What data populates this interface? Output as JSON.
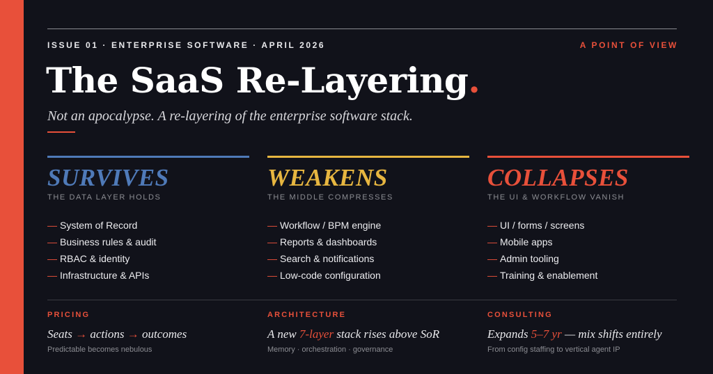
{
  "colors": {
    "accent": "#e8503a",
    "survives": "#4f7ab8",
    "weakens": "#e7b640",
    "collapses": "#e8503a",
    "background": "#11121a"
  },
  "header": {
    "meta": "ISSUE 01 · ENTERPRISE SOFTWARE · APRIL 2026",
    "tag": "A POINT OF VIEW",
    "title": "The SaaS Re-Layering",
    "title_dot": ".",
    "subtitle": "Not an apocalypse. A re-layering of the enterprise software stack."
  },
  "columns": [
    {
      "heading": "SURVIVES",
      "sub": "THE DATA LAYER HOLDS",
      "items": [
        "System of Record",
        "Business rules & audit",
        "RBAC & identity",
        "Infrastructure & APIs"
      ]
    },
    {
      "heading": "WEAKENS",
      "sub": "THE MIDDLE COMPRESSES",
      "items": [
        "Workflow / BPM engine",
        "Reports & dashboards",
        "Search & notifications",
        "Low-code configuration"
      ]
    },
    {
      "heading": "COLLAPSES",
      "sub": "THE UI & WORKFLOW VANISH",
      "items": [
        "UI / forms / screens",
        "Mobile apps",
        "Admin tooling",
        "Training & enablement"
      ]
    }
  ],
  "footer": {
    "pricing": {
      "label": "PRICING",
      "line_a": "Seats",
      "arrow_1": "→",
      "line_b": "actions",
      "arrow_2": "→",
      "line_c": "outcomes",
      "note": "Predictable becomes nebulous"
    },
    "architecture": {
      "label": "ARCHITECTURE",
      "line_a": "A new",
      "highlight": "7-layer",
      "line_b": "stack rises above SoR",
      "note": "Memory · orchestration · governance"
    },
    "consulting": {
      "label": "CONSULTING",
      "line_a": "Expands",
      "highlight": "5–7 yr",
      "line_b": "— mix shifts entirely",
      "note": "From config staffing to vertical agent IP"
    }
  },
  "dash": "—"
}
